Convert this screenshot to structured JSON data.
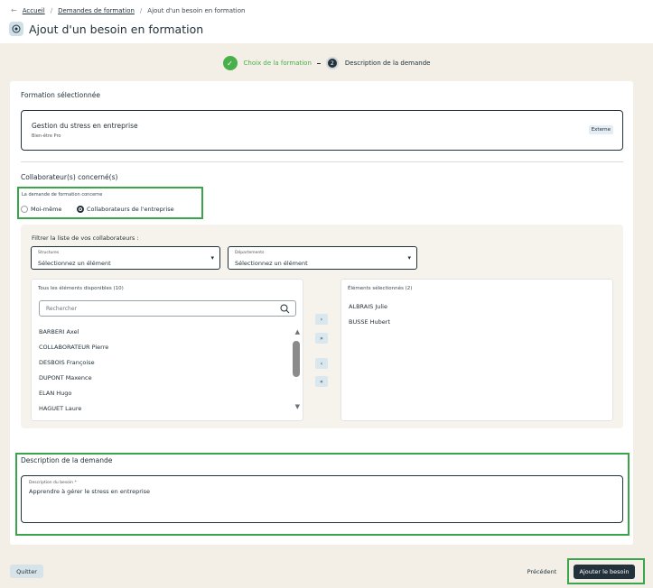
{
  "breadcrumb": {
    "home": "Accueil",
    "requests": "Demandes de formation",
    "current": "Ajout d'un besoin en formation"
  },
  "page": {
    "title": "Ajout d'un besoin en formation"
  },
  "stepper": {
    "step1_label": "Choix de la formation",
    "step2_number": "2",
    "step2_label": "Description de la demande"
  },
  "formation": {
    "section_title": "Formation sélectionnée",
    "name": "Gestion du stress en entreprise",
    "category": "Bien-être Pro",
    "badge": "Externe"
  },
  "collaborators": {
    "section_title": "Collaborateur(s) concerné(s)",
    "concerne_label": "La demande de formation concerne",
    "option_self": "Moi-même",
    "option_company": "Collaborateurs de l'entreprise",
    "selected_option": "Collaborateurs de l'entreprise",
    "filter_title": "Filtrer la liste de vos collaborateurs :",
    "structures": {
      "label": "Structures",
      "value": "Sélectionnez un élément"
    },
    "departements": {
      "label": "Départements",
      "value": "Sélectionnez un élément"
    },
    "available": {
      "title": "Tous les éléments disponibles (10)",
      "search_placeholder": "Rechercher",
      "items": [
        "BARBERI Axel",
        "COLLABORATEUR Pierre",
        "DESBOIS Françoise",
        "DUPONT Maxence",
        "ELAN Hugo",
        "HAGUET Laure"
      ]
    },
    "selected": {
      "title": "Éléments sélectionnés (2)",
      "items": [
        "ALBRAIS Julie",
        "BUSSE Hubert"
      ]
    },
    "move_buttons": [
      "›",
      "»",
      "‹",
      "«"
    ]
  },
  "description": {
    "section_title": "Description de la demande",
    "field_label": "Description du besoin *",
    "value": "Apprendre à gérer le stress en entreprise"
  },
  "footer": {
    "quit": "Quitter",
    "previous": "Précédent",
    "submit": "Ajouter le besoin"
  },
  "colors": {
    "accent_dark": "#23323a",
    "success_green": "#48b04a",
    "highlight_green": "#3aa54b",
    "background": "#f3efe6"
  }
}
